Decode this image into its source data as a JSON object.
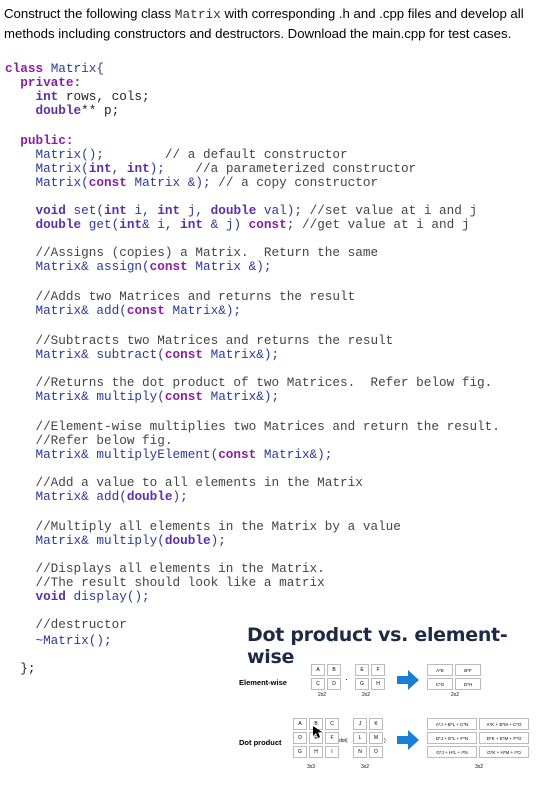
{
  "intro": {
    "part1": "Construct the following class ",
    "class_name": "Matrix",
    "part2": " with corresponding .h and .cpp files and develop all methods including constructors and destructors. Download the main.cpp for test cases."
  },
  "code_lines": [
    [
      [
        "kw",
        "class"
      ],
      [
        "id",
        " Matrix{"
      ]
    ],
    [
      [
        "kw",
        "  private:"
      ]
    ],
    [
      [
        "ty",
        "    int"
      ],
      [
        "tx",
        " rows, cols;"
      ]
    ],
    [
      [
        "ty",
        "    double"
      ],
      [
        "tx",
        "** p;"
      ]
    ],
    [],
    [
      [
        "kw",
        "  public:"
      ]
    ],
    [
      [
        "id",
        "    Matrix();"
      ],
      [
        "cm",
        "        // a default constructor"
      ]
    ],
    [
      [
        "id",
        "    Matrix("
      ],
      [
        "ty",
        "int"
      ],
      [
        "id",
        ", "
      ],
      [
        "ty",
        "int"
      ],
      [
        "id",
        ");"
      ],
      [
        "cm",
        "    //a parameterized constructor"
      ]
    ],
    [
      [
        "id",
        "    Matrix("
      ],
      [
        "kw",
        "const"
      ],
      [
        "id",
        " Matrix &);"
      ],
      [
        "cm",
        " // a copy constructor"
      ]
    ],
    [],
    [
      [
        "ty",
        "    void"
      ],
      [
        "id",
        " set("
      ],
      [
        "ty",
        "int"
      ],
      [
        "id",
        " i, "
      ],
      [
        "ty",
        "int"
      ],
      [
        "id",
        " j, "
      ],
      [
        "ty",
        "double"
      ],
      [
        "id",
        " val);"
      ],
      [
        "cm",
        " //set value at i and j"
      ]
    ],
    [
      [
        "ty",
        "    double"
      ],
      [
        "id",
        " get("
      ],
      [
        "ty",
        "int"
      ],
      [
        "id",
        "& i, "
      ],
      [
        "ty",
        "int"
      ],
      [
        "id",
        " & j) "
      ],
      [
        "kw",
        "const"
      ],
      [
        "id",
        ";"
      ],
      [
        "cm",
        " //get value at i and j"
      ]
    ],
    [],
    [
      [
        "cm",
        "    //Assigns (copies) a Matrix.  Return the same"
      ]
    ],
    [
      [
        "id",
        "    Matrix& assign("
      ],
      [
        "kw",
        "const"
      ],
      [
        "id",
        " Matrix &);"
      ]
    ],
    [],
    [
      [
        "cm",
        "    //Adds two Matrices and returns the result"
      ]
    ],
    [
      [
        "id",
        "    Matrix& add("
      ],
      [
        "kw",
        "const"
      ],
      [
        "id",
        " Matrix&);"
      ]
    ],
    [],
    [
      [
        "cm",
        "    //Subtracts two Matrices and returns the result"
      ]
    ],
    [
      [
        "id",
        "    Matrix& subtract("
      ],
      [
        "kw",
        "const"
      ],
      [
        "id",
        " Matrix&);"
      ]
    ],
    [],
    [
      [
        "cm",
        "    //Returns the dot product of two Matrices.  Refer below fig."
      ]
    ],
    [
      [
        "id",
        "    Matrix& multiply("
      ],
      [
        "kw",
        "const"
      ],
      [
        "id",
        " Matrix&);"
      ]
    ],
    [],
    [
      [
        "cm",
        "    //Element-wise multiplies two Matrices and return the result."
      ]
    ],
    [
      [
        "cm",
        "    //Refer below fig."
      ]
    ],
    [
      [
        "id",
        "    Matrix& multiplyElement("
      ],
      [
        "kw",
        "const"
      ],
      [
        "id",
        " Matrix&);"
      ]
    ],
    [],
    [
      [
        "cm",
        "    //Add a value to all elements in the Matrix"
      ]
    ],
    [
      [
        "id",
        "    Matrix& add("
      ],
      [
        "ty",
        "double"
      ],
      [
        "id",
        ");"
      ]
    ],
    [],
    [
      [
        "cm",
        "    //Multiply all elements in the Matrix by a value"
      ]
    ],
    [
      [
        "id",
        "    Matrix& multiply("
      ],
      [
        "ty",
        "double"
      ],
      [
        "id",
        ");"
      ]
    ],
    [],
    [
      [
        "cm",
        "    //Displays all elements in the Matrix."
      ]
    ],
    [
      [
        "cm",
        "    //The result should look like a matrix"
      ]
    ],
    [
      [
        "ty",
        "    void"
      ],
      [
        "id",
        " display();"
      ]
    ],
    [],
    [
      [
        "cm",
        "    //destructor"
      ]
    ],
    [
      [
        "id",
        "    ~Matrix();"
      ]
    ],
    [],
    [
      [
        "tx",
        "  };"
      ]
    ]
  ],
  "figure": {
    "title": "Dot product vs. element-wise",
    "ew_label": "Element-wise",
    "dp_label": "Dot product",
    "ew_a": [
      "A",
      "B",
      "C",
      "D"
    ],
    "ew_b": [
      "E",
      "F",
      "G",
      "H"
    ],
    "ew_op": "·",
    "ew_result": [
      "A*E",
      "B*F",
      "C*G",
      "D*H"
    ],
    "ew_dims": [
      "2x2",
      "2x2",
      "2x2"
    ],
    "dp_a": [
      "A",
      "B",
      "C",
      "D",
      "E",
      "F",
      "G",
      "H",
      "I"
    ],
    "dp_b": [
      "J",
      "K",
      "L",
      "M",
      "N",
      "O"
    ],
    "dp_op": "dot(",
    "dp_close": ")",
    "dp_result": [
      "A*J + B*L + C*N",
      "A*K + B*M + C*O",
      "D*J + E*L + F*N",
      "D*K + E*M + F*O",
      "G*J + H*L + I*N",
      "G*K + H*M + I*O"
    ],
    "dp_dims": [
      "3x3",
      "3x2",
      "3x2"
    ],
    "accent": "#1a7fd6"
  }
}
